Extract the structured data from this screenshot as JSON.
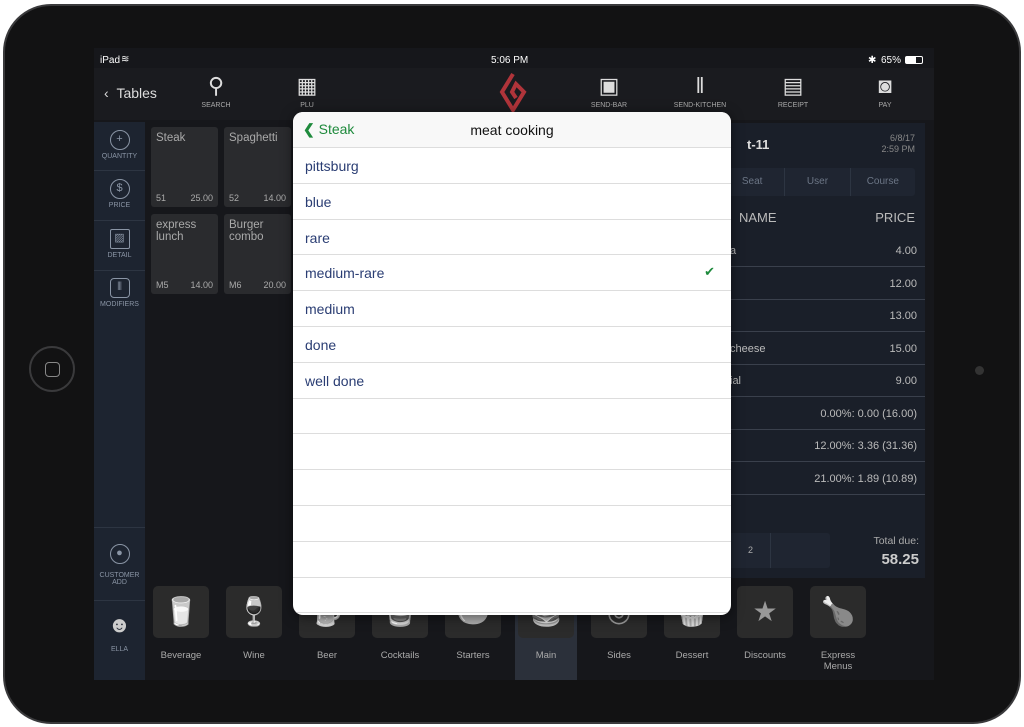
{
  "status_bar": {
    "device": "iPad",
    "time": "5:06 PM",
    "battery": "65%"
  },
  "nav": {
    "back_label": "Tables",
    "buttons": [
      {
        "label": "SEARCH",
        "icon": "search-icon"
      },
      {
        "label": "PLU",
        "icon": "grid-icon"
      },
      {
        "label": "SEND-BAR",
        "icon": "beer-mug-icon"
      },
      {
        "label": "SEND-KITCHEN",
        "icon": "fork-knife-icon"
      },
      {
        "label": "RECEIPT",
        "icon": "receipt-icon"
      },
      {
        "label": "PAY",
        "icon": "cash-icon"
      }
    ],
    "brand_color": "#b0343a"
  },
  "sidebar": {
    "items": [
      {
        "label": "QUANTITY",
        "icon": "plus-circle-icon"
      },
      {
        "label": "PRICE",
        "icon": "dollar-circle-icon"
      },
      {
        "label": "DETAIL",
        "icon": "images-icon"
      },
      {
        "label": "MODIFIERS",
        "icon": "shakers-icon"
      }
    ],
    "customer": {
      "line1": "CUSTOMER",
      "line2": "ADD"
    },
    "user": "ELLA"
  },
  "products": [
    {
      "name": "Steak",
      "code": "51",
      "price": "25.00"
    },
    {
      "name": "Spaghetti",
      "code": "52",
      "price": "14.00"
    },
    {
      "name": "express lunch",
      "code": "M5",
      "price": "14.00"
    },
    {
      "name": "Burger combo",
      "code": "M6",
      "price": "20.00"
    }
  ],
  "order": {
    "table": "t-11",
    "date": "6/8/17",
    "time": "2:59 PM",
    "tabs": [
      "Seat",
      "User",
      "Course"
    ],
    "col_name": "NAME",
    "col_price": "PRICE",
    "rows": [
      {
        "name": "a",
        "price": "4.00"
      },
      {
        "name": "",
        "price": "12.00"
      },
      {
        "name": "",
        "price": "13.00"
      },
      {
        "name": "cheese",
        "price": "15.00"
      },
      {
        "name": "ial",
        "price": "9.00"
      },
      {
        "name": "",
        "price": "0.00%: 0.00 (16.00)"
      },
      {
        "name": "",
        "price": "12.00%: 3.36 (31.36)"
      },
      {
        "name": "",
        "price": "21.00%: 1.89 (10.89)"
      }
    ],
    "seat_value": "2",
    "total_label": "Total due:",
    "total": "58.25"
  },
  "categories": [
    {
      "label": "Beverage",
      "icon": "glasses-icon"
    },
    {
      "label": "Wine",
      "icon": "wine-icon"
    },
    {
      "label": "Beer",
      "icon": "beer-icon"
    },
    {
      "label": "Cocktails",
      "icon": "cocktail-icon"
    },
    {
      "label": "Starters",
      "icon": "bowl-icon"
    },
    {
      "label": "Main",
      "icon": "burger-icon",
      "selected": true
    },
    {
      "label": "Sides",
      "icon": "plate-icon"
    },
    {
      "label": "Dessert",
      "icon": "cupcake-icon"
    },
    {
      "label": "Discounts",
      "icon": "star-icon"
    },
    {
      "label": "Express Menus",
      "icon": "express-icon"
    }
  ],
  "popover": {
    "back_label": "Steak",
    "title": "meat cooking",
    "options": [
      "pittsburg",
      "blue",
      "rare",
      "medium-rare",
      "medium",
      "done",
      "well done"
    ],
    "selected": "medium-rare",
    "accent": "#1e8a3c"
  }
}
